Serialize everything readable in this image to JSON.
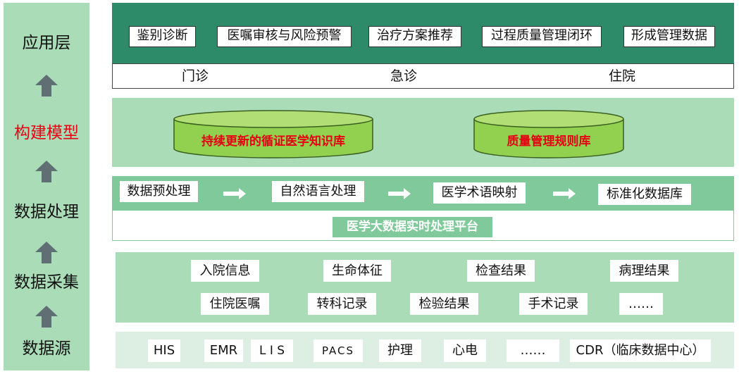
{
  "layers": {
    "app": "应用层",
    "model": "构建模型",
    "process": "数据处理",
    "collect": "数据采集",
    "source": "数据源"
  },
  "colors": {
    "dark_green": "#2e8b6a",
    "light_green": "#a9dcb7",
    "mid_green": "#7fc99a",
    "pale_green": "#dcefe2",
    "db_fill": "#92d050",
    "highlight_red": "#e60012",
    "arrow_gray": "#5f6f74"
  },
  "application": {
    "functions": [
      "鉴别诊断",
      "医嘱审核与风险预警",
      "治疗方案推荐",
      "过程质量管理闭环",
      "形成管理数据"
    ],
    "departments": [
      "门诊",
      "急诊",
      "住院"
    ]
  },
  "model": {
    "databases": [
      "持续更新的循证医学知识库",
      "质量管理规则库"
    ]
  },
  "processing": {
    "steps": [
      "数据预处理",
      "自然语言处理",
      "医学术语映射",
      "标准化数据库"
    ],
    "platform": "医学大数据实时处理平台"
  },
  "collection": {
    "row1": [
      "入院信息",
      "生命体征",
      "检查结果",
      "病理结果"
    ],
    "row2": [
      "住院医嘱",
      "转科记录",
      "检验结果",
      "手术记录",
      "……"
    ]
  },
  "sources": [
    "HIS",
    "EMR",
    "L I S",
    "PACS",
    "护理",
    "心电",
    "……",
    "CDR（临床数据中心）"
  ]
}
